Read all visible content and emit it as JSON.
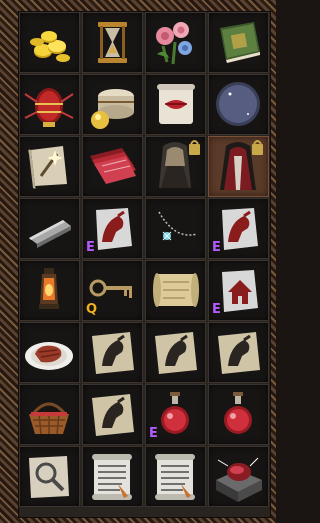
{
  "inventory": {
    "slots": [
      {
        "icon": "gold-coins-icon"
      },
      {
        "icon": "hourglass-icon"
      },
      {
        "icon": "flowers-icon"
      },
      {
        "icon": "green-book-icon"
      },
      {
        "icon": "red-egg-icon"
      },
      {
        "icon": "hat-box-icon"
      },
      {
        "icon": "lips-scroll-icon"
      },
      {
        "icon": "crescent-moon-icon"
      },
      {
        "icon": "sparkle-scroll-icon"
      },
      {
        "icon": "red-cloth-icon"
      },
      {
        "icon": "hooded-cloak-locked-icon"
      },
      {
        "icon": "red-cloak-locked-icon",
        "selected": true
      },
      {
        "icon": "iron-bar-icon"
      },
      {
        "icon": "wolf-tag-icon",
        "badge": "E",
        "badge_color": "#b45bff"
      },
      {
        "icon": "chain-amulet-icon"
      },
      {
        "icon": "wolf-tag-icon",
        "badge": "E",
        "badge_color": "#b45bff"
      },
      {
        "icon": "lantern-icon"
      },
      {
        "icon": "key-icon",
        "badge": "Q",
        "badge_color": "#f0b020"
      },
      {
        "icon": "rolled-map-icon"
      },
      {
        "icon": "house-tag-icon",
        "badge": "E",
        "badge_color": "#b45bff"
      },
      {
        "icon": "steak-plate-icon"
      },
      {
        "icon": "wolf-note-icon"
      },
      {
        "icon": "wolf-note-icon"
      },
      {
        "icon": "wolf-note-icon"
      },
      {
        "icon": "basket-icon"
      },
      {
        "icon": "wolf-note-icon"
      },
      {
        "icon": "red-potion-icon",
        "badge": "E",
        "badge_color": "#b45bff"
      },
      {
        "icon": "red-potion-icon"
      },
      {
        "icon": "magnifier-note-icon"
      },
      {
        "icon": "letter-scroll-icon"
      },
      {
        "icon": "letter-scroll-icon"
      },
      {
        "icon": "ruby-box-icon"
      }
    ]
  }
}
